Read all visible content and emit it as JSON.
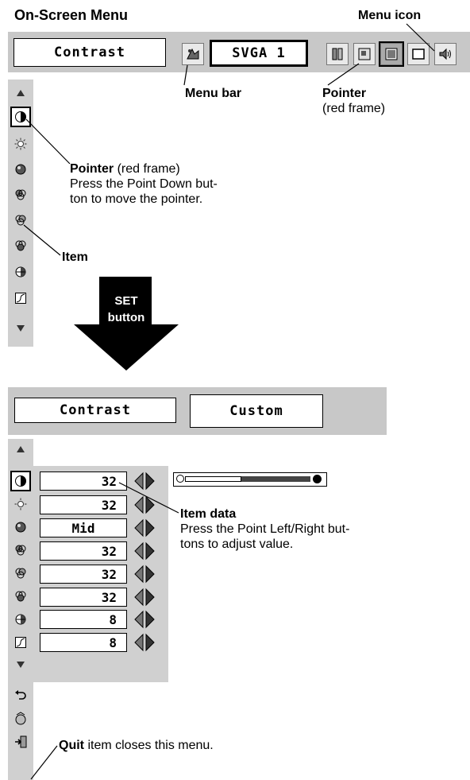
{
  "heading": "On-Screen Menu",
  "top_menu": {
    "title": "Contrast",
    "mode": "SVGA 1",
    "icons": [
      "image-select-icon",
      "pc-adjust-icon",
      "image-adjust-icon",
      "screen-icon",
      "sound-icon"
    ]
  },
  "top_items": [
    "up-arrow-icon",
    "contrast-icon",
    "brightness-icon",
    "color-temp-icon",
    "white-balance-red-icon",
    "white-balance-green-icon",
    "white-balance-blue-icon",
    "sharpness-icon",
    "gamma-icon",
    "down-arrow-icon"
  ],
  "set_button": {
    "line1": "SET",
    "line2": "button"
  },
  "bottom_menu": {
    "title": "Contrast",
    "mode": "Custom",
    "items": [
      {
        "icon": "contrast-icon",
        "value": "32"
      },
      {
        "icon": "brightness-icon",
        "value": "32"
      },
      {
        "icon": "color-temp-icon",
        "value": "Mid"
      },
      {
        "icon": "white-balance-red-icon",
        "value": "32"
      },
      {
        "icon": "white-balance-green-icon",
        "value": "32"
      },
      {
        "icon": "white-balance-blue-icon",
        "value": "32"
      },
      {
        "icon": "sharpness-icon",
        "value": "8"
      },
      {
        "icon": "gamma-icon",
        "value": "8"
      }
    ],
    "slider_level": 0.45,
    "extra_icons": [
      "down-arrow-icon",
      "reset-icon",
      "store-icon",
      "quit-icon"
    ]
  },
  "annotations": {
    "menu_icon": "Menu icon",
    "menu_bar": "Menu bar",
    "pointer_top_bold": "Pointer",
    "pointer_top_sub": "(red frame)",
    "pointer_side_bold": "Pointer",
    "pointer_side_rest": " (red frame)",
    "pointer_side_line2": "Press the Point Down but-",
    "pointer_side_line3": "ton to move the pointer.",
    "item": "Item",
    "item_data_bold": "Item data",
    "item_data_line2": "Press the Point Left/Right but-",
    "item_data_line3": "tons to adjust value.",
    "quit_bold": "Quit",
    "quit_rest": " item closes this menu."
  }
}
